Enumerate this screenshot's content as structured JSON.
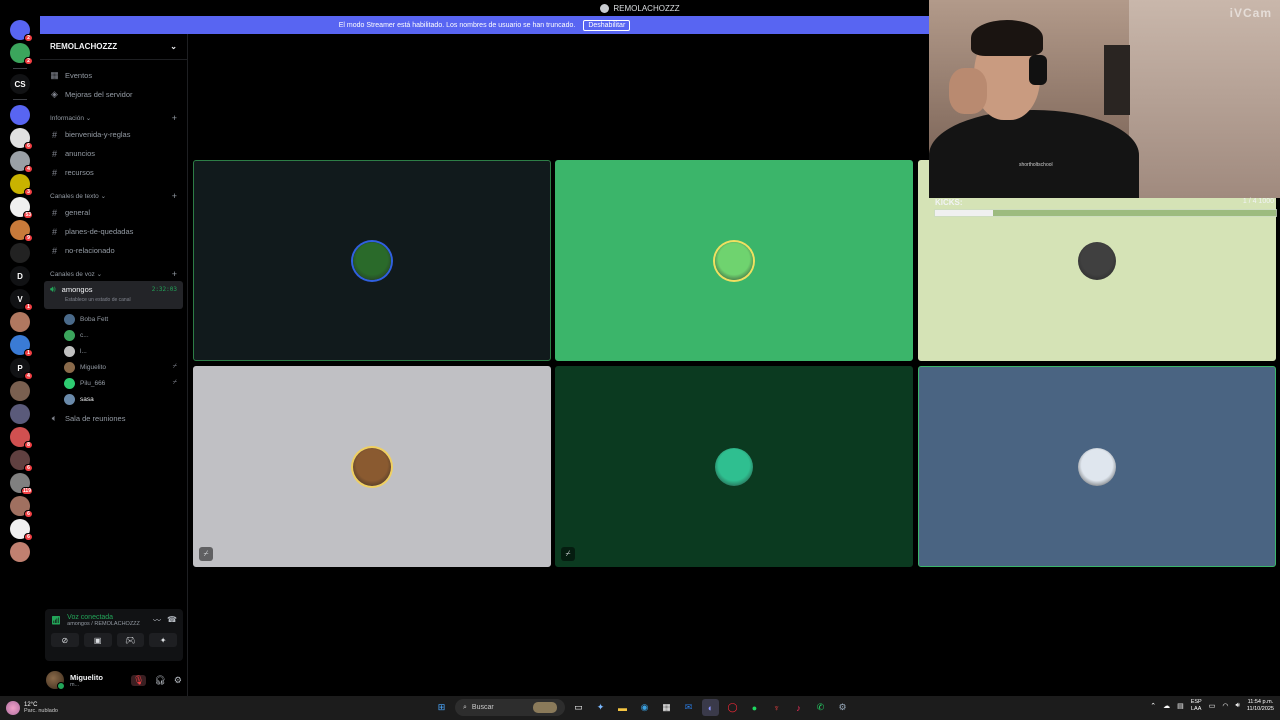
{
  "window": {
    "title": "REMOLACHOZZZ"
  },
  "banner": {
    "text": "El modo Streamer está habilitado. Los nombres de usuario se han truncado.",
    "button": "Deshabilitar"
  },
  "server_rail": [
    {
      "label": "",
      "color": "#5865f2",
      "badge": "2"
    },
    {
      "label": "",
      "color": "#3ba55c",
      "badge": "2"
    },
    {
      "label": "CS",
      "color": "#111214",
      "badge": ""
    },
    {
      "label": "",
      "color": "#5865f2",
      "badge": ""
    },
    {
      "label": "",
      "color": "#e0e0e0",
      "badge": "6"
    },
    {
      "label": "",
      "color": "#9aa0a6",
      "badge": "4"
    },
    {
      "label": "",
      "color": "#c9b300",
      "badge": "3"
    },
    {
      "label": "",
      "color": "#f0f0f0",
      "badge": "53"
    },
    {
      "label": "",
      "color": "#c87a3a",
      "badge": "9"
    },
    {
      "label": "",
      "color": "#222222",
      "badge": ""
    },
    {
      "label": "D",
      "color": "#111214",
      "badge": ""
    },
    {
      "label": "V",
      "color": "#111214",
      "badge": "1"
    },
    {
      "label": "",
      "color": "#b07860",
      "badge": ""
    },
    {
      "label": "",
      "color": "#3a7bd5",
      "badge": "1"
    },
    {
      "label": "P",
      "color": "#111214",
      "badge": "4"
    },
    {
      "label": "",
      "color": "#7a6050",
      "badge": ""
    },
    {
      "label": "",
      "color": "#5a5a7a",
      "badge": ""
    },
    {
      "label": "",
      "color": "#d05050",
      "badge": "8"
    },
    {
      "label": "",
      "color": "#604040",
      "badge": "6"
    },
    {
      "label": "",
      "color": "#808080",
      "badge": "119"
    },
    {
      "label": "",
      "color": "#a07060",
      "badge": "6"
    },
    {
      "label": "",
      "color": "#f0f0f0",
      "badge": "6"
    },
    {
      "label": "",
      "color": "#c08070",
      "badge": ""
    }
  ],
  "sidebar": {
    "server_name": "REMOLACHOZZZ",
    "top_items": [
      {
        "icon": "calendar-icon",
        "label": "Eventos"
      },
      {
        "icon": "boost-icon",
        "label": "Mejoras del servidor"
      }
    ],
    "categories": [
      {
        "name": "Información",
        "channels": [
          "bienvenida-y-reglas",
          "anuncios",
          "recursos"
        ]
      },
      {
        "name": "Canales de texto",
        "channels": [
          "general",
          "planes-de-quedadas",
          "no-relacionado"
        ]
      }
    ],
    "voice_category": "Canales de voz",
    "active_voice": {
      "name": "amongos",
      "timer": "2:32:03",
      "status": "Establece un estado de canal"
    },
    "voice_users": [
      {
        "name": "Boba Fett",
        "color": "#4a6a8a",
        "muted": false
      },
      {
        "name": "c...",
        "color": "#3ba55c",
        "muted": false
      },
      {
        "name": "l...",
        "color": "#c0c0c0",
        "muted": false
      },
      {
        "name": "Miguelito",
        "color": "#8a6a4a",
        "muted": true
      },
      {
        "name": "Pilu_666",
        "color": "#2ecc71",
        "muted": true
      },
      {
        "name": "sasa",
        "color": "#6a8aaa",
        "muted": false
      }
    ],
    "other_voice": "Sala de reuniones"
  },
  "voice_panel": {
    "title": "Voz conectada",
    "subtitle": "amongos / REMOLACHOZZZ"
  },
  "user_panel": {
    "name": "Miguelito",
    "status": "m..."
  },
  "tiles": [
    {
      "bg": "#111a1c",
      "border": "#2d7d46",
      "avatar": "#2a6a2a",
      "ring": "#3060e0",
      "muted": false
    },
    {
      "bg": "#3bb56a",
      "border": "#3bb56a",
      "avatar": "#6fd36f",
      "ring": "#f0e060",
      "muted": false
    },
    {
      "bg": "#d5e3b6",
      "border": "#d5e3b6",
      "avatar": "#404040",
      "ring": "#d5e3b6",
      "muted": false
    },
    {
      "bg": "#c0c0c4",
      "border": "#c0c0c4",
      "avatar": "#8a5a30",
      "ring": "#f0d060",
      "muted": true
    },
    {
      "bg": "#0b3a20",
      "border": "#0b3a20",
      "avatar": "#2fbf90",
      "ring": "#0b3a20",
      "muted": true
    },
    {
      "bg": "#4a6482",
      "border": "#3bb56a",
      "avatar": "#dfe6ee",
      "ring": "#4a6482",
      "muted": false
    }
  ],
  "webcam": {
    "watermark": "iVCam",
    "shirt_text": "shortholtschool"
  },
  "kicks": {
    "label": "KICKS:",
    "value": "1 / 4  1000",
    "progress": 0.17
  },
  "taskbar": {
    "weather_temp": "12°C",
    "weather_desc": "Parc. nublado",
    "search_placeholder": "Buscar",
    "lang_top": "ESP",
    "lang_bottom": "LAA",
    "time": "11:54 p.m.",
    "date": "11/10/2025"
  }
}
